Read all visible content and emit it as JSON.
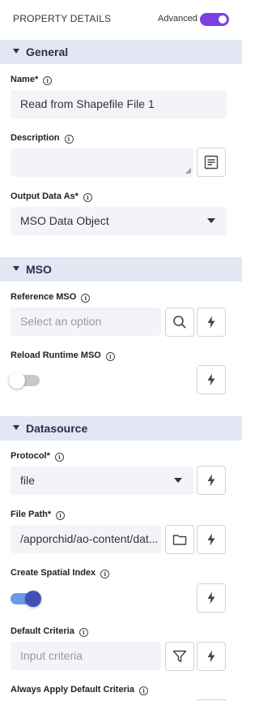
{
  "header": {
    "title": "PROPERTY DETAILS",
    "advanced_label": "Advanced",
    "advanced_enabled": true
  },
  "sections": {
    "general": "General",
    "mso": "MSO",
    "datasource": "Datasource"
  },
  "fields": {
    "name": {
      "label": "Name*",
      "value": "Read from Shapefile File 1"
    },
    "description": {
      "label": "Description",
      "value": ""
    },
    "output_data_as": {
      "label": "Output Data As*",
      "value": "MSO Data Object"
    },
    "reference_mso": {
      "label": "Reference MSO",
      "placeholder": "Select an option"
    },
    "reload_runtime_mso": {
      "label": "Reload Runtime MSO",
      "enabled": false
    },
    "protocol": {
      "label": "Protocol*",
      "value": "file"
    },
    "file_path": {
      "label": "File Path*",
      "value": "/apporchid/ao-content/dat..."
    },
    "create_spatial_index": {
      "label": "Create Spatial Index",
      "enabled": true
    },
    "default_criteria": {
      "label": "Default Criteria",
      "placeholder": "Input criteria"
    },
    "always_apply_default_criteria": {
      "label": "Always Apply Default Criteria"
    }
  },
  "icons": {
    "notes": "notes-icon",
    "search": "search-icon",
    "lightning": "lightning-icon",
    "folder": "folder-icon",
    "filter": "filter-icon",
    "info": "info-icon",
    "chevron": "chevron-down-icon"
  },
  "colors": {
    "accent_purple": "#7b3fe4",
    "section_bg": "#e3e6f3",
    "toggle_on_track": "#6c9ae8",
    "toggle_on_knob": "#3f51b5",
    "input_bg": "#f3f4f7"
  }
}
